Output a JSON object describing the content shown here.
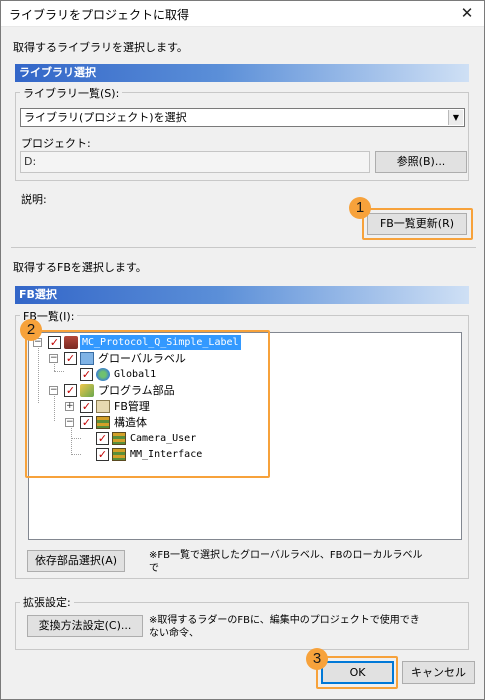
{
  "window": {
    "title": "ライブラリをプロジェクトに取得"
  },
  "intro_text": "取得するライブラリを選択します。",
  "library_section": {
    "header": "ライブラリ選択",
    "list_label": "ライブラリ一覧(S):",
    "list_selected": "ライブラリ(プロジェクト)を選択",
    "project_label": "プロジェクト:",
    "project_value": "D:",
    "browse_button": "参照(B)...",
    "description_label": "説明:",
    "fb_update_button": "FB一覧更新(R)"
  },
  "fb_intro_text": "取得するFBを選択します。",
  "fb_section": {
    "header": "FB選択",
    "list_label": "FB一覧(I):",
    "tree": [
      {
        "label": "MC_Protocol_Q_Simple_Label",
        "checked": true,
        "icon": "project-icon",
        "selected": true
      },
      {
        "label": "グローバルラベル",
        "checked": true,
        "icon": "global-label-icon"
      },
      {
        "label": "Global1",
        "checked": true,
        "icon": "globe-icon"
      },
      {
        "label": "プログラム部品",
        "checked": true,
        "icon": "program-parts-icon"
      },
      {
        "label": "FB管理",
        "checked": true,
        "icon": "fb-icon"
      },
      {
        "label": "構造体",
        "checked": true,
        "icon": "structure-icon"
      },
      {
        "label": "Camera_User",
        "checked": true,
        "icon": "structure-icon"
      },
      {
        "label": "MM_Interface",
        "checked": true,
        "icon": "structure-icon"
      }
    ],
    "dependency_button": "依存部品選択(A)",
    "note_line1": "※FB一覧で選択したグローバルラベル、FBのローカルラベル",
    "note_line2": "で"
  },
  "extension": {
    "label": "拡張設定:",
    "conversion_button": "変換方法設定(C)...",
    "note_line1": "※取得するラダーのFBに、編集中のプロジェクトで使用でき",
    "note_line2": "ない命令、"
  },
  "footer": {
    "ok_button": "OK",
    "cancel_button": "キャンセル"
  },
  "annotations": {
    "badge1": "1",
    "badge2": "2",
    "badge3": "3",
    "accent_color": "#f7a23b"
  }
}
